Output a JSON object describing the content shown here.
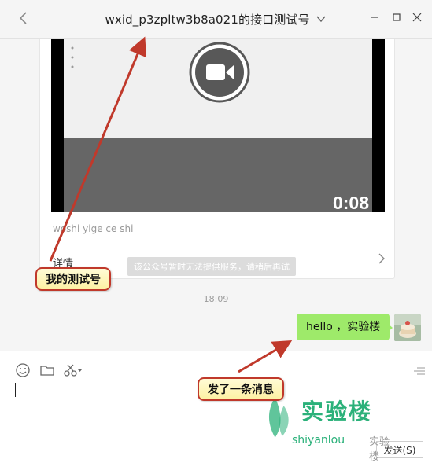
{
  "window": {
    "title": "wxid_p3zpltw3b8a021的接口测试号"
  },
  "card": {
    "video_duration": "0:08",
    "caption": "woshi yige ce shi",
    "details_label": "详情"
  },
  "system_notice": "该公众号暂时无法提供服务，请稍后再试",
  "timestamp": "18:09",
  "message": {
    "text": "hello ，实验楼"
  },
  "input": {
    "send_label": "发送(S)"
  },
  "annotations": {
    "callout_1": "我的测试号",
    "callout_2": "发了一条消息"
  },
  "watermark": {
    "brand": "实验楼",
    "url": "shiyanlou",
    "social": "实验楼"
  },
  "colors": {
    "bubble": "#9eea6a",
    "annotation_border": "#c0392b",
    "brand": "#2bb17a"
  }
}
